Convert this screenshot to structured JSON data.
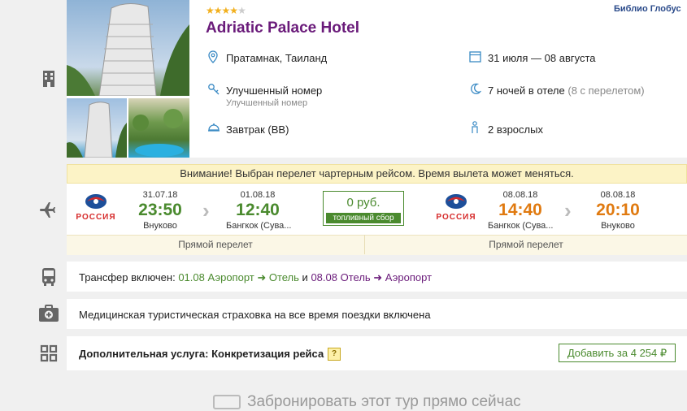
{
  "hotel": {
    "stars": 4,
    "name": "Adriatic Palace Hotel",
    "brand": "Библио Глобус",
    "location": "Пратамнак, Таиланд",
    "dates": "31 июля — 08 августа",
    "room": "Улучшенный номер",
    "room_sub": "Улучшенный номер",
    "nights": "7 ночей в отеле",
    "nights_extra": "(8 с перелетом)",
    "meal": "Завтрак (BB)",
    "guests": "2 взрослых"
  },
  "flight": {
    "warning": "Внимание! Выбран перелет чартерным рейсом. Время вылета может меняться.",
    "airline_logo_text": "РОССИЯ",
    "outbound": {
      "dep_date": "31.07.18",
      "dep_time": "23:50",
      "dep_airport": "Внуково",
      "arr_date": "01.08.18",
      "arr_time": "12:40",
      "arr_airport": "Бангкок (Сува...",
      "type": "Прямой перелет"
    },
    "fuel": {
      "price": "0 руб.",
      "label": "топливный сбор"
    },
    "return": {
      "dep_date": "08.08.18",
      "dep_time": "14:40",
      "dep_airport": "Бангкок (Сува...",
      "arr_date": "08.08.18",
      "arr_time": "20:10",
      "arr_airport": "Внуково",
      "type": "Прямой перелет"
    }
  },
  "transfer": {
    "prefix": "Трансфер включен:",
    "date1": "01.08",
    "route1": "Аэропорт ➜ Отель",
    "and": "и",
    "date2": "08.08",
    "route2": "Отель ➜ Аэропорт"
  },
  "insurance": {
    "text": "Медицинская туристическая страховка на все время поездки включена"
  },
  "extra": {
    "text": "Дополнительная услуга: Конкретизация рейса",
    "help": "?",
    "button": "Добавить за 4 254 ₽"
  },
  "footer": {
    "text": "Забронировать этот тур прямо сейчас"
  },
  "colors": {
    "accent_purple": "#6a1b7a",
    "green": "#4a8a2e",
    "orange": "#e07a10",
    "warning_bg": "#fcf3c6"
  }
}
